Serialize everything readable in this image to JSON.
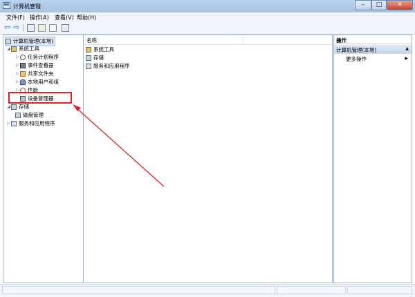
{
  "window": {
    "title": "计算机管理"
  },
  "menu": {
    "items": [
      "文件(F)",
      "操作(A)",
      "查看(V)",
      "帮助(H)"
    ]
  },
  "tree": {
    "root": "计算机管理(本地)",
    "system_tools": "系统工具",
    "task_scheduler": "任务计划程序",
    "event_viewer": "事件查看器",
    "shared_folders": "共享文件夹",
    "local_users": "本地用户和组",
    "performance": "性能",
    "device_manager": "设备管理器",
    "storage": "存储",
    "disk_management": "磁盘管理",
    "services": "服务和应用程序"
  },
  "list": {
    "column_name": "名称",
    "items": [
      "系统工具",
      "存储",
      "服务和应用程序"
    ]
  },
  "actions": {
    "header": "操作",
    "section": "计算机管理(本地)",
    "more": "更多操作"
  },
  "colors": {
    "highlight": "#e31e24",
    "selection": "#dce8f6"
  }
}
